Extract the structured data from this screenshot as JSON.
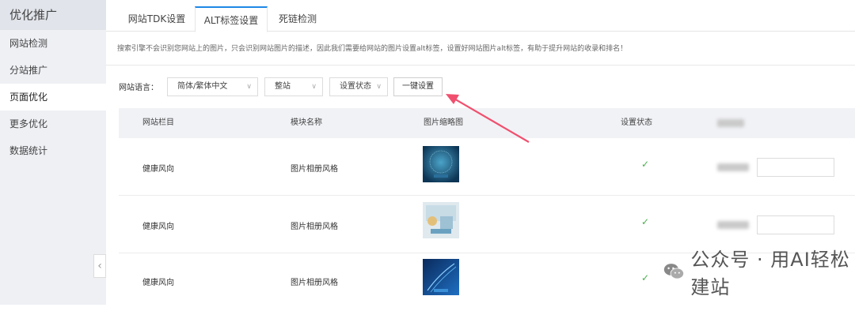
{
  "sidebar": {
    "title": "优化推广",
    "items": [
      {
        "label": "网站检测"
      },
      {
        "label": "分站推广"
      },
      {
        "label": "页面优化"
      },
      {
        "label": "更多优化"
      },
      {
        "label": "数据统计"
      }
    ],
    "collapse_glyph": "‹"
  },
  "tabs": [
    {
      "label": "网站TDK设置"
    },
    {
      "label": "ALT标签设置"
    },
    {
      "label": "死链检测"
    }
  ],
  "description": "搜索引擎不会识别您网站上的图片，只会识别网站图片的描述，因此我们需要给网站的图片设置alt标签，设置好网站图片alt标签，有助于提升网站的收录和排名！",
  "filters": {
    "language_label": "网站语言：",
    "language_value": "简体/繁体中文",
    "scope_value": "整站",
    "status_value": "设置状态",
    "one_click_button": "一键设置"
  },
  "table": {
    "headers": [
      "网站栏目",
      "模块名称",
      "图片缩略图",
      "设置状态"
    ],
    "rows": [
      {
        "column": "健康风向",
        "module": "图片相册风格",
        "status": "check"
      },
      {
        "column": "健康风向",
        "module": "图片相册风格",
        "status": "check"
      },
      {
        "column": "健康风向",
        "module": "图片相册风格",
        "status": "check"
      }
    ]
  },
  "watermark": {
    "text": "公众号 · 用AI轻松建站"
  },
  "colors": {
    "accent": "#1e88e5",
    "arrow": "#f0506e",
    "check": "#4caf50"
  }
}
